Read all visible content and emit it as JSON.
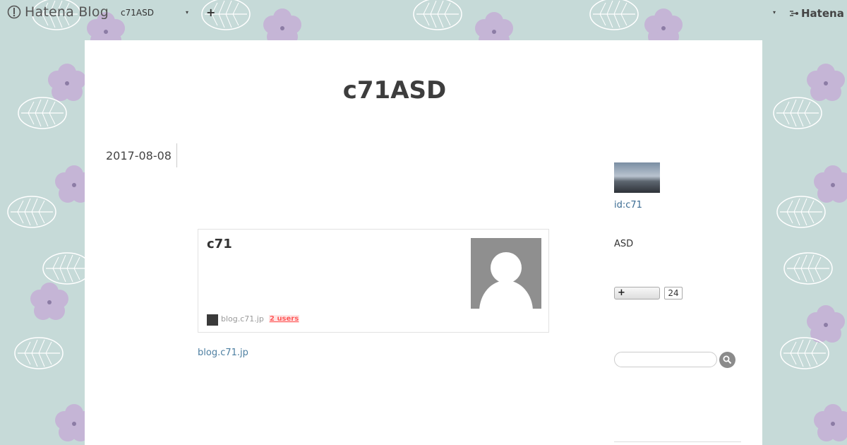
{
  "topbar": {
    "logo_text": "Hatena Blog",
    "blog_name": "c71ASD",
    "plus_glyph": "+",
    "caret_glyph": "▾",
    "hatena_text": "Hatena"
  },
  "blog": {
    "title": "c71ASD"
  },
  "entry": {
    "date": "2017-08-08",
    "card": {
      "title": "c71",
      "site": "blog.c71.jp",
      "users": "2 users"
    },
    "link_text": "blog.c71.jp"
  },
  "sidebar": {
    "user_id": "id:c71",
    "description": "ASD",
    "bookmark_plus": "+",
    "bookmark_count": "24"
  },
  "colors": {
    "background": "#c6dad8",
    "flower": "#c5b5d6",
    "link": "#4d7fa1",
    "users_badge": "#ff5b5b"
  },
  "icons": [
    "hatena-blog-logo-icon",
    "chevron-down-icon",
    "plus-icon",
    "hatena-logo-icon",
    "user-placeholder-icon",
    "search-icon"
  ]
}
